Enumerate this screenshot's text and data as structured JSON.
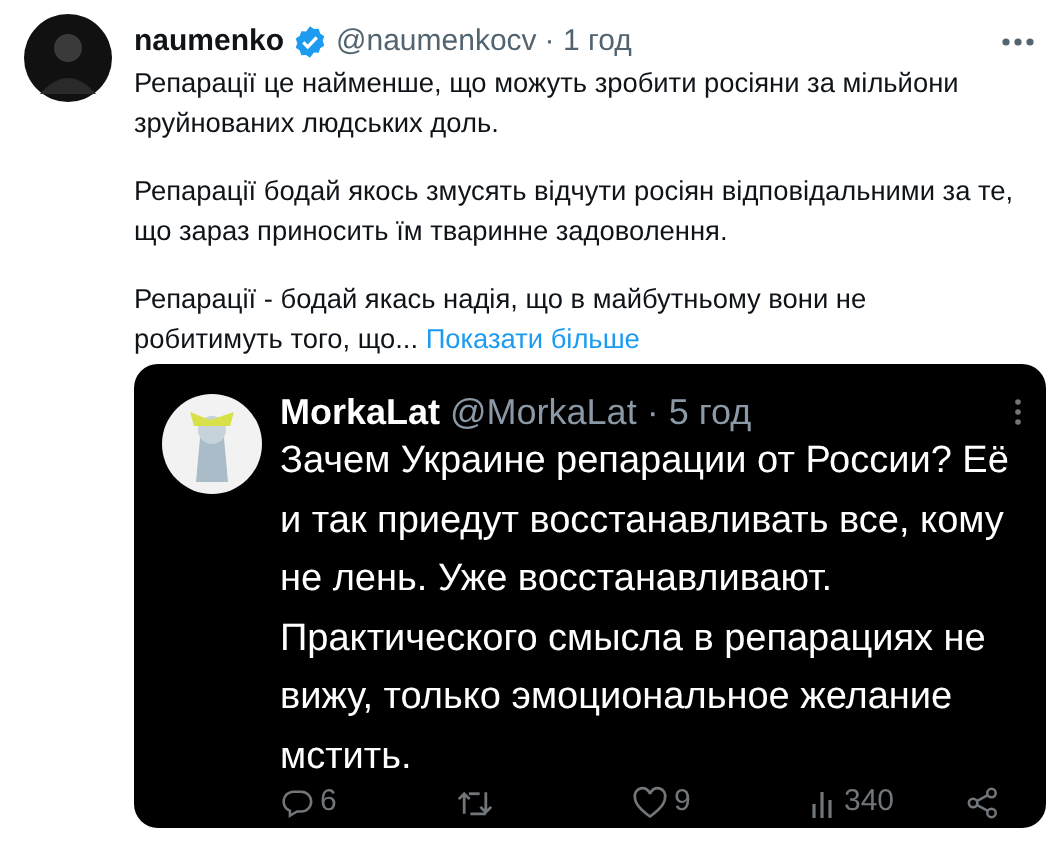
{
  "tweet": {
    "name": "naumenko",
    "verified": true,
    "handle": "@naumenkocv",
    "time": "· 1 год",
    "paragraphs": [
      "Репарації це найменше, що можуть зробити росіяни за мільйони зруйнованих людських доль.",
      "Репарації бодай якось змусять відчути росіян відповідальними за те, що зараз приносить їм тваринне задоволення.",
      "Репарації - бодай якась надія, що в майбутньому вони не робитимуть того, що..."
    ],
    "show_more": "Показати більше"
  },
  "embedded_screenshot": {
    "name": "MorkaLat",
    "handle": "@MorkaLat",
    "time": "· 5 год",
    "text": "Зачем Украине репарации от России? Её и так приедут восстанавливать все, кому не лень. Уже восстанавливают. Практического смысла в репарациях не вижу, только эмоциональное желание мстить.",
    "actions": [
      {
        "kind": "reply",
        "count": "6"
      },
      {
        "kind": "retweet"
      },
      {
        "kind": "like",
        "count": "9"
      },
      {
        "kind": "views",
        "count": "340"
      },
      {
        "kind": "share"
      }
    ]
  }
}
